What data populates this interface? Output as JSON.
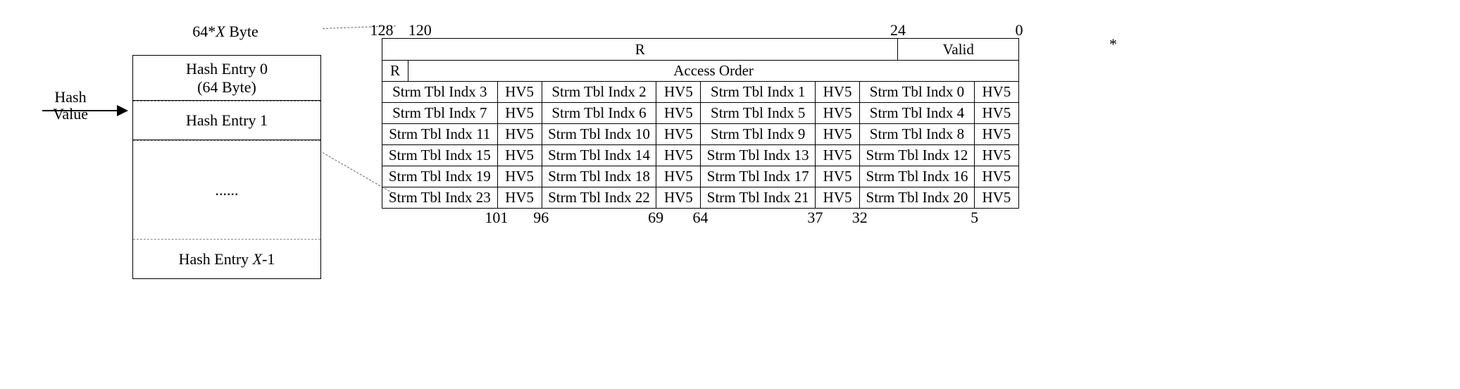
{
  "left": {
    "title_prefix": "64*",
    "title_var": "X",
    "title_suffix": " Byte",
    "row0_line1": "Hash Entry 0",
    "row0_line2": "(64 Byte)",
    "row1": "Hash Entry 1",
    "ellipsis": "......",
    "rowLast_prefix": "Hash Entry ",
    "rowLast_var": "X",
    "rowLast_suffix": "-1",
    "pointer_label_line1": "Hash",
    "pointer_label_line2": "Value"
  },
  "ticks_top": {
    "t128": "128",
    "t120": "120",
    "t24": "24",
    "t0": "0"
  },
  "hdr1": {
    "r": "R",
    "valid": "Valid"
  },
  "hdr2": {
    "r": "R",
    "access": "Access Order"
  },
  "rows": [
    {
      "c3": "Strm Tbl Indx 3",
      "h3": "HV5",
      "c2": "Strm Tbl Indx 2",
      "h2": "HV5",
      "c1": "Strm Tbl Indx 1",
      "h1": "HV5",
      "c0": "Strm Tbl Indx 0",
      "h0": "HV5"
    },
    {
      "c3": "Strm Tbl Indx 7",
      "h3": "HV5",
      "c2": "Strm Tbl Indx 6",
      "h2": "HV5",
      "c1": "Strm Tbl Indx 5",
      "h1": "HV5",
      "c0": "Strm Tbl Indx 4",
      "h0": "HV5"
    },
    {
      "c3": "Strm Tbl Indx 11",
      "h3": "HV5",
      "c2": "Strm Tbl Indx 10",
      "h2": "HV5",
      "c1": "Strm Tbl Indx 9",
      "h1": "HV5",
      "c0": "Strm Tbl Indx 8",
      "h0": "HV5"
    },
    {
      "c3": "Strm Tbl Indx 15",
      "h3": "HV5",
      "c2": "Strm Tbl Indx 14",
      "h2": "HV5",
      "c1": "Strm Tbl Indx 13",
      "h1": "HV5",
      "c0": "Strm Tbl Indx 12",
      "h0": "HV5"
    },
    {
      "c3": "Strm Tbl Indx 19",
      "h3": "HV5",
      "c2": "Strm Tbl Indx 18",
      "h2": "HV5",
      "c1": "Strm Tbl Indx 17",
      "h1": "HV5",
      "c0": "Strm Tbl Indx 16",
      "h0": "HV5"
    },
    {
      "c3": "Strm Tbl Indx 23",
      "h3": "HV5",
      "c2": "Strm Tbl Indx 22",
      "h2": "HV5",
      "c1": "Strm Tbl Indx 21",
      "h1": "HV5",
      "c0": "Strm Tbl Indx 20",
      "h0": "HV5"
    }
  ],
  "ticks_bottom": {
    "t101": "101",
    "t96": "96",
    "t69": "69",
    "t64": "64",
    "t37": "37",
    "t32": "32",
    "t5": "5"
  },
  "asterisk": "*"
}
